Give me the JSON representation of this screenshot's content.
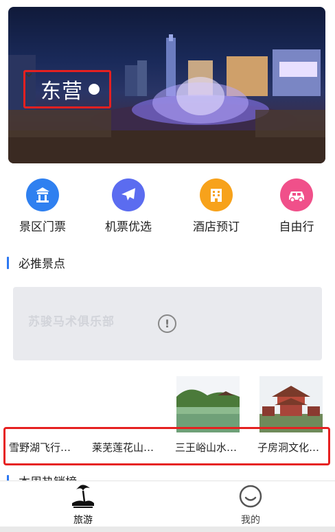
{
  "hero": {
    "city": "东营",
    "chevron_icon": "chevron-down-icon"
  },
  "categories": [
    {
      "label": "景区门票",
      "icon": "temple-icon",
      "color": "#2f80f0"
    },
    {
      "label": "机票优选",
      "icon": "airplane-icon",
      "color": "#5b6cf0"
    },
    {
      "label": "酒店预订",
      "icon": "hotel-icon",
      "color": "#f7a21b"
    },
    {
      "label": "自由行",
      "icon": "car-icon",
      "color": "#f0508a"
    }
  ],
  "must_see": {
    "title": "必推景点",
    "ad_text": "苏骏马术俱乐部",
    "alert_glyph": "!"
  },
  "spots": [
    {
      "name": "雪野湖飞行…"
    },
    {
      "name": "莱芜莲花山…"
    },
    {
      "name": "三王峪山水…"
    },
    {
      "name": "子房洞文化…"
    }
  ],
  "weekly_hot": {
    "title": "本周热销榜"
  },
  "tabbar": {
    "tabs": [
      {
        "label": "旅游",
        "icon": "beach-icon"
      },
      {
        "label": "我的",
        "icon": "smiley-icon"
      }
    ]
  },
  "colors": {
    "accent": "#2b77f2",
    "highlight_border": "#e62020"
  }
}
